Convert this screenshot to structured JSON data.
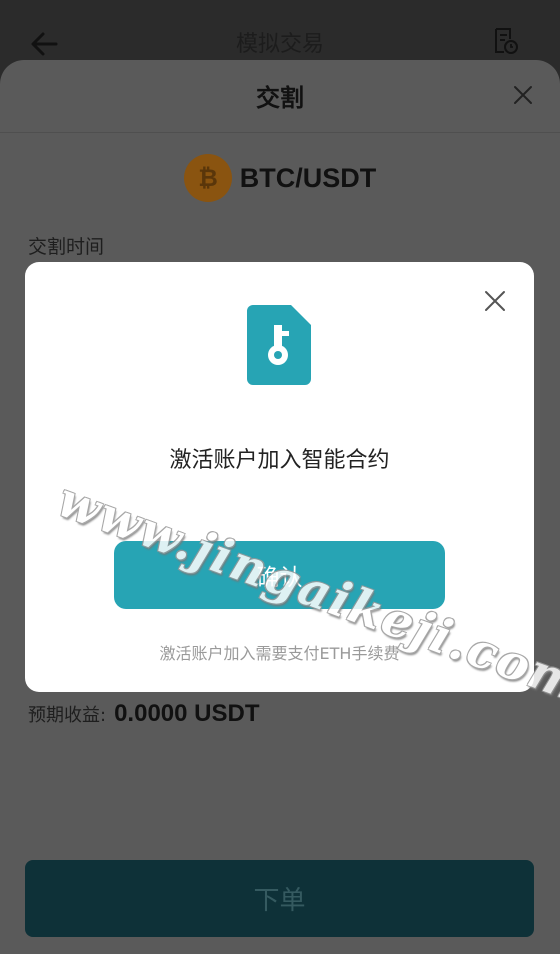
{
  "appbar": {
    "title": "模拟交易"
  },
  "sheet": {
    "title": "交割",
    "pair": "BTC/USDT",
    "delivery_time_label": "交割时间",
    "expected_profit_label": "预期收益:",
    "expected_profit_value": "0.0000 USDT",
    "order_button": "下单"
  },
  "modal": {
    "message": "激活账户加入智能合约",
    "confirm_button": "确认",
    "fee_note": "激活账户加入需要支付ETH手续费"
  },
  "watermark": "www.jingaikeji.com",
  "colors": {
    "accent": "#27a4b4",
    "coin": "#f7931a"
  },
  "icons": [
    "back-arrow-icon",
    "document-clock-icon",
    "close-icon",
    "bitcoin-icon",
    "key-file-icon"
  ]
}
